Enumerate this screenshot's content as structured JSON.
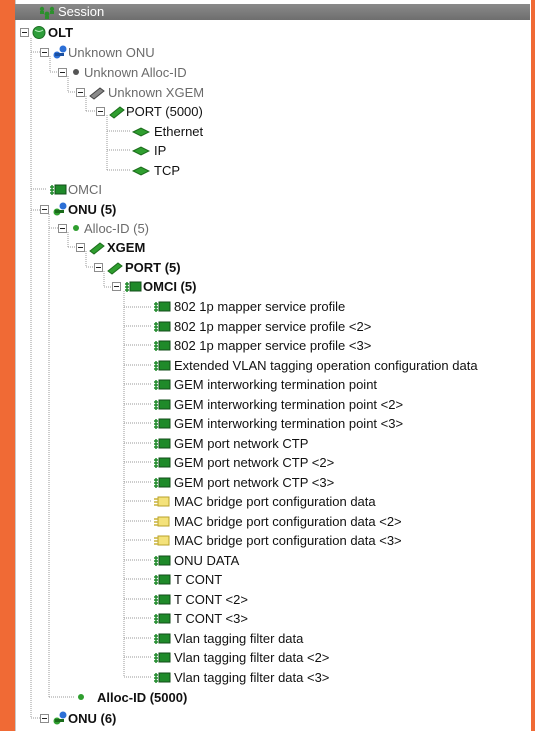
{
  "window": {
    "title": "Session"
  },
  "tree": {
    "olt": "OLT",
    "unknown_onu": "Unknown ONU",
    "unknown_alloc": "Unknown Alloc-ID",
    "unknown_xgem": "Unknown XGEM",
    "port_5000": "PORT (5000)",
    "ethernet": "Ethernet",
    "ip": "IP",
    "tcp": "TCP",
    "omci": "OMCI",
    "onu5": "ONU (5)",
    "alloc5": "Alloc-ID (5)",
    "xgem": "XGEM",
    "port5": "PORT (5)",
    "omci5": "OMCI (5)",
    "omci_items": [
      "802 1p mapper service profile",
      "802 1p mapper service profile <2>",
      "802 1p mapper service profile <3>",
      "Extended VLAN tagging operation configuration data",
      "GEM interworking termination point",
      "GEM interworking termination point <2>",
      "GEM interworking termination point <3>",
      "GEM port network CTP",
      "GEM port network CTP <2>",
      "GEM port network CTP <3>",
      "MAC bridge port configuration data",
      "MAC bridge port configuration data <2>",
      "MAC bridge port configuration data <3>",
      "ONU DATA",
      "T CONT",
      "T CONT <2>",
      "T CONT <3>",
      "Vlan tagging filter data",
      "Vlan tagging filter data <2>",
      "Vlan tagging filter data <3>"
    ],
    "alloc5000": "Alloc-ID (5000)",
    "onu6": "ONU (6)"
  },
  "colors": {
    "background": "#f06a35",
    "panel": "#ffffff",
    "titlebar": "#7a7a7a",
    "globe": "#2e9e3a",
    "onu_blue": "#2c6fd6",
    "port_green": "#2f9e2f",
    "omci_green": "#1f8a2a",
    "mac_yellow": "#e9d24a"
  }
}
